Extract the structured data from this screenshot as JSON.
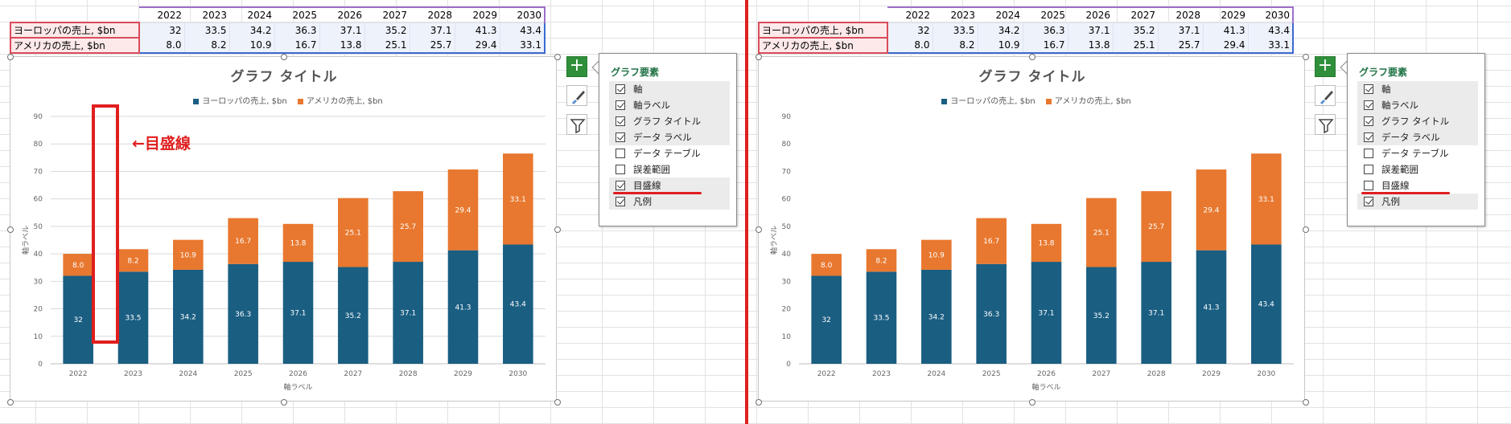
{
  "table": {
    "years": [
      "2022",
      "2023",
      "2024",
      "2025",
      "2026",
      "2027",
      "2028",
      "2029",
      "2030"
    ],
    "rows": [
      {
        "label": "ヨーロッパの売上, $bn",
        "values": [
          "32",
          "33.5",
          "34.2",
          "36.3",
          "37.1",
          "35.2",
          "37.1",
          "41.3",
          "43.4"
        ]
      },
      {
        "label": "アメリカの売上, $bn",
        "values": [
          "8.0",
          "8.2",
          "10.9",
          "16.7",
          "13.8",
          "25.1",
          "25.7",
          "29.4",
          "33.1"
        ]
      }
    ]
  },
  "chart_data": {
    "type": "bar",
    "stacked": true,
    "title": "グラフ タイトル",
    "xlabel": "軸ラベル",
    "ylabel": "軸ラベル",
    "categories": [
      "2022",
      "2023",
      "2024",
      "2025",
      "2026",
      "2027",
      "2028",
      "2029",
      "2030"
    ],
    "series": [
      {
        "name": "ヨーロッパの売上, $bn",
        "color": "#1a5e82",
        "values": [
          32,
          33.5,
          34.2,
          36.3,
          37.1,
          35.2,
          37.1,
          41.3,
          43.4
        ],
        "labels": [
          "32",
          "33.5",
          "34.2",
          "36.3",
          "37.1",
          "35.2",
          "37.1",
          "41.3",
          "43.4"
        ]
      },
      {
        "name": "アメリカの売上, $bn",
        "color": "#e8782f",
        "values": [
          8.0,
          8.2,
          10.9,
          16.7,
          13.8,
          25.1,
          25.7,
          29.4,
          33.1
        ],
        "labels": [
          "8.0",
          "8.2",
          "10.9",
          "16.7",
          "13.8",
          "25.1",
          "25.7",
          "29.4",
          "33.1"
        ]
      }
    ],
    "yticks": [
      "0",
      "10",
      "20",
      "30",
      "40",
      "50",
      "60",
      "70",
      "80",
      "90"
    ],
    "ylim": [
      0,
      90
    ],
    "legend_position": "top"
  },
  "popup": {
    "title": "グラフ要素",
    "options": [
      {
        "label": "軸"
      },
      {
        "label": "軸ラベル"
      },
      {
        "label": "グラフ タイトル"
      },
      {
        "label": "データ ラベル"
      },
      {
        "label": "データ テーブル"
      },
      {
        "label": "誤差範囲"
      },
      {
        "label": "目盛線"
      },
      {
        "label": "凡例"
      }
    ],
    "left_checked": [
      true,
      true,
      true,
      true,
      false,
      false,
      true,
      true
    ],
    "right_checked": [
      true,
      true,
      true,
      true,
      false,
      false,
      false,
      true
    ]
  },
  "annotation": {
    "text": "←目盛線"
  },
  "icons": {
    "plus": "plus-icon",
    "brush": "paintbrush-icon",
    "filter": "filter-icon"
  }
}
